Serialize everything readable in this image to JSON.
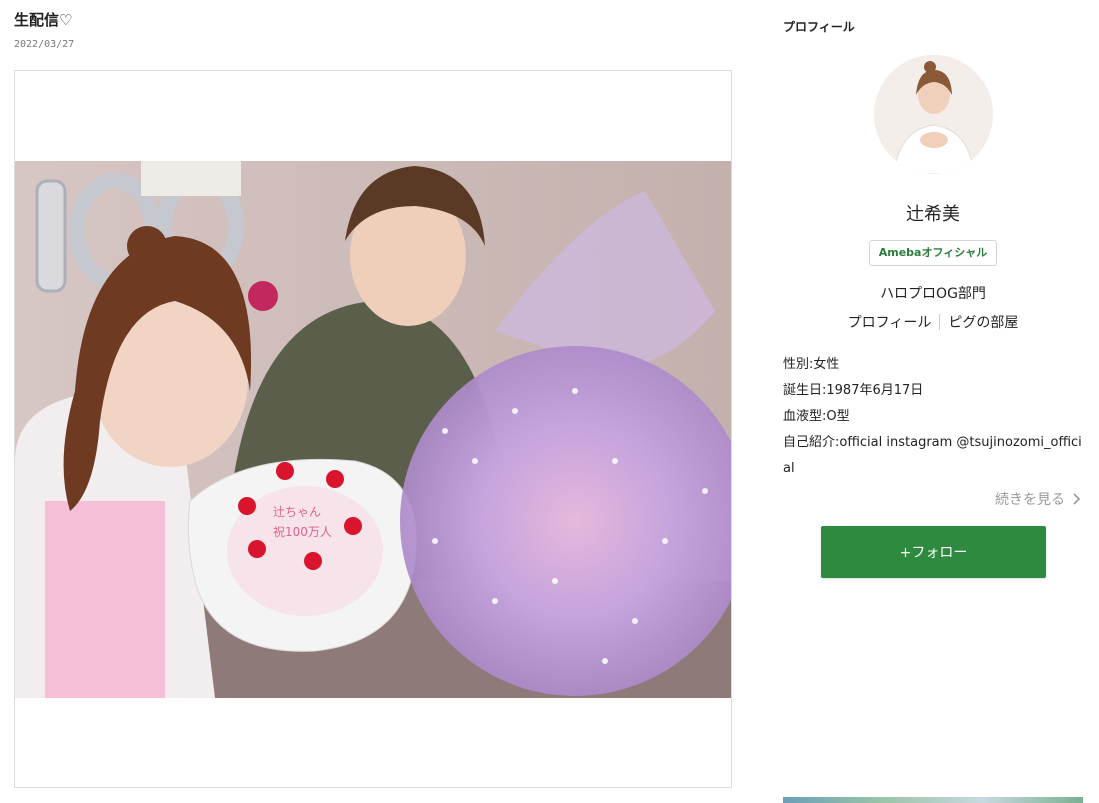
{
  "post": {
    "title": "生配信♡",
    "date": "2022/03/27"
  },
  "sidebar": {
    "heading": "プロフィール",
    "author_name": "辻希美",
    "official_badge": "Amebaオフィシャル",
    "genre": "ハロプロOG部門",
    "links": {
      "profile": "プロフィール",
      "room": "ピグの部屋"
    },
    "gender_label": "性別:",
    "gender": "女性",
    "birthday_label": "誕生日:",
    "birthday": "1987年6月17日",
    "blood_label": "血液型:",
    "blood": "O型",
    "intro_label": "自己紹介:",
    "intro": "official instagram @tsujinozomi_official",
    "read_more": "続きを見る",
    "follow_button": "+フォロー"
  },
  "photo_texts": {
    "cake_line1": "辻ちゃん",
    "cake_line2": "祝100万人"
  },
  "colors": {
    "follow_green": "#2d8a3e",
    "badge_green": "#2a7d3a",
    "date_gray": "#777777"
  }
}
